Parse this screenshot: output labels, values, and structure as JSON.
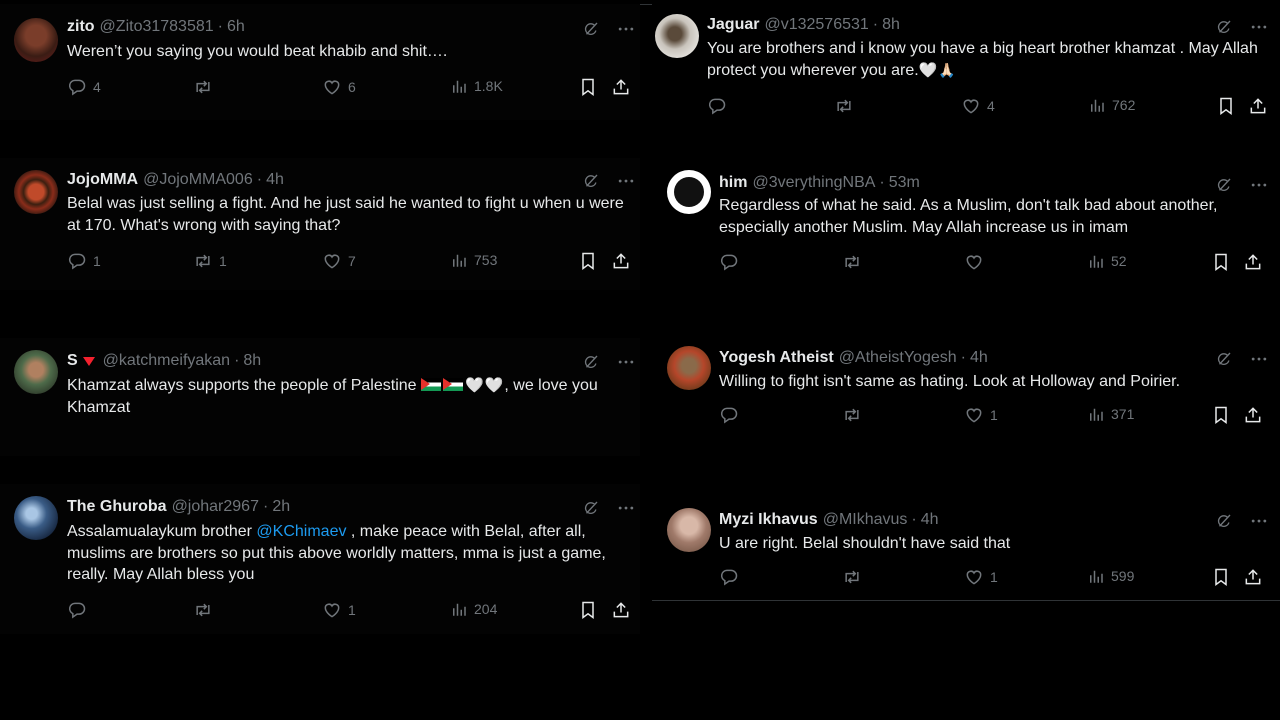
{
  "left": [
    {
      "name": "zito",
      "handle": "@Zito31783581",
      "time": "6h",
      "text": "Weren’t you saying you would beat khabib and shit….",
      "replies": "4",
      "reposts": "",
      "likes": "6",
      "views": "1.8K"
    },
    {
      "name": "JojoMMA",
      "handle": "@JojoMMA006",
      "time": "4h",
      "text": "Belal was just selling a fight. And he just said he wanted to fight u when u were at 170. What's wrong with saying that?",
      "replies": "1",
      "reposts": "1",
      "likes": "7",
      "views": "753"
    },
    {
      "name": "S",
      "handle": "@katchmeifyakan",
      "time": "8h",
      "text": "Khamzat always supports the people of Palestine",
      "text_end": ", we love you Khamzat",
      "replies": "",
      "reposts": "",
      "likes": "",
      "views": ""
    },
    {
      "name": "The Ghuroba",
      "handle": "@johar2967",
      "time": "2h",
      "text_pre": "Assalamualaykum brother ",
      "mention": "@KChimaev",
      "text_post": " , make peace with Belal, after all, muslims are brothers so put this above worldly matters, mma is just a game, really. May Allah bless you",
      "replies": "",
      "reposts": "",
      "likes": "1",
      "views": "204"
    }
  ],
  "right": [
    {
      "name": "Jaguar",
      "handle": "@v132576531",
      "time": "8h",
      "text": "You are brothers and i know you have a big heart brother khamzat . May Allah  protect you wherever you are.",
      "replies": "",
      "reposts": "",
      "likes": "4",
      "views": "762"
    },
    {
      "name": "him",
      "handle": "@3verythingNBA",
      "time": "53m",
      "text": "Regardless of what he said. As a Muslim, don't talk bad about another, especially another Muslim. May Allah increase us in imam",
      "replies": "",
      "reposts": "",
      "likes": "",
      "views": "52"
    },
    {
      "name": "Yogesh Atheist",
      "handle": "@AtheistYogesh",
      "time": "4h",
      "text": "Willing to fight isn't same as hating. Look at Holloway and Poirier.",
      "replies": "",
      "reposts": "",
      "likes": "1",
      "views": "371"
    },
    {
      "name": "Myzi Ikhavus",
      "handle": "@MIkhavus",
      "time": "4h",
      "text": "U are right. Belal shouldn't have said that",
      "replies": "",
      "reposts": "",
      "likes": "1",
      "views": "599"
    }
  ],
  "emoji": {
    "heart": "🤍",
    "hands": "🙏🏻"
  },
  "colors": {
    "background": "#000000",
    "text": "#e7e9ea",
    "muted": "#71767b",
    "link": "#1d9bf0"
  }
}
